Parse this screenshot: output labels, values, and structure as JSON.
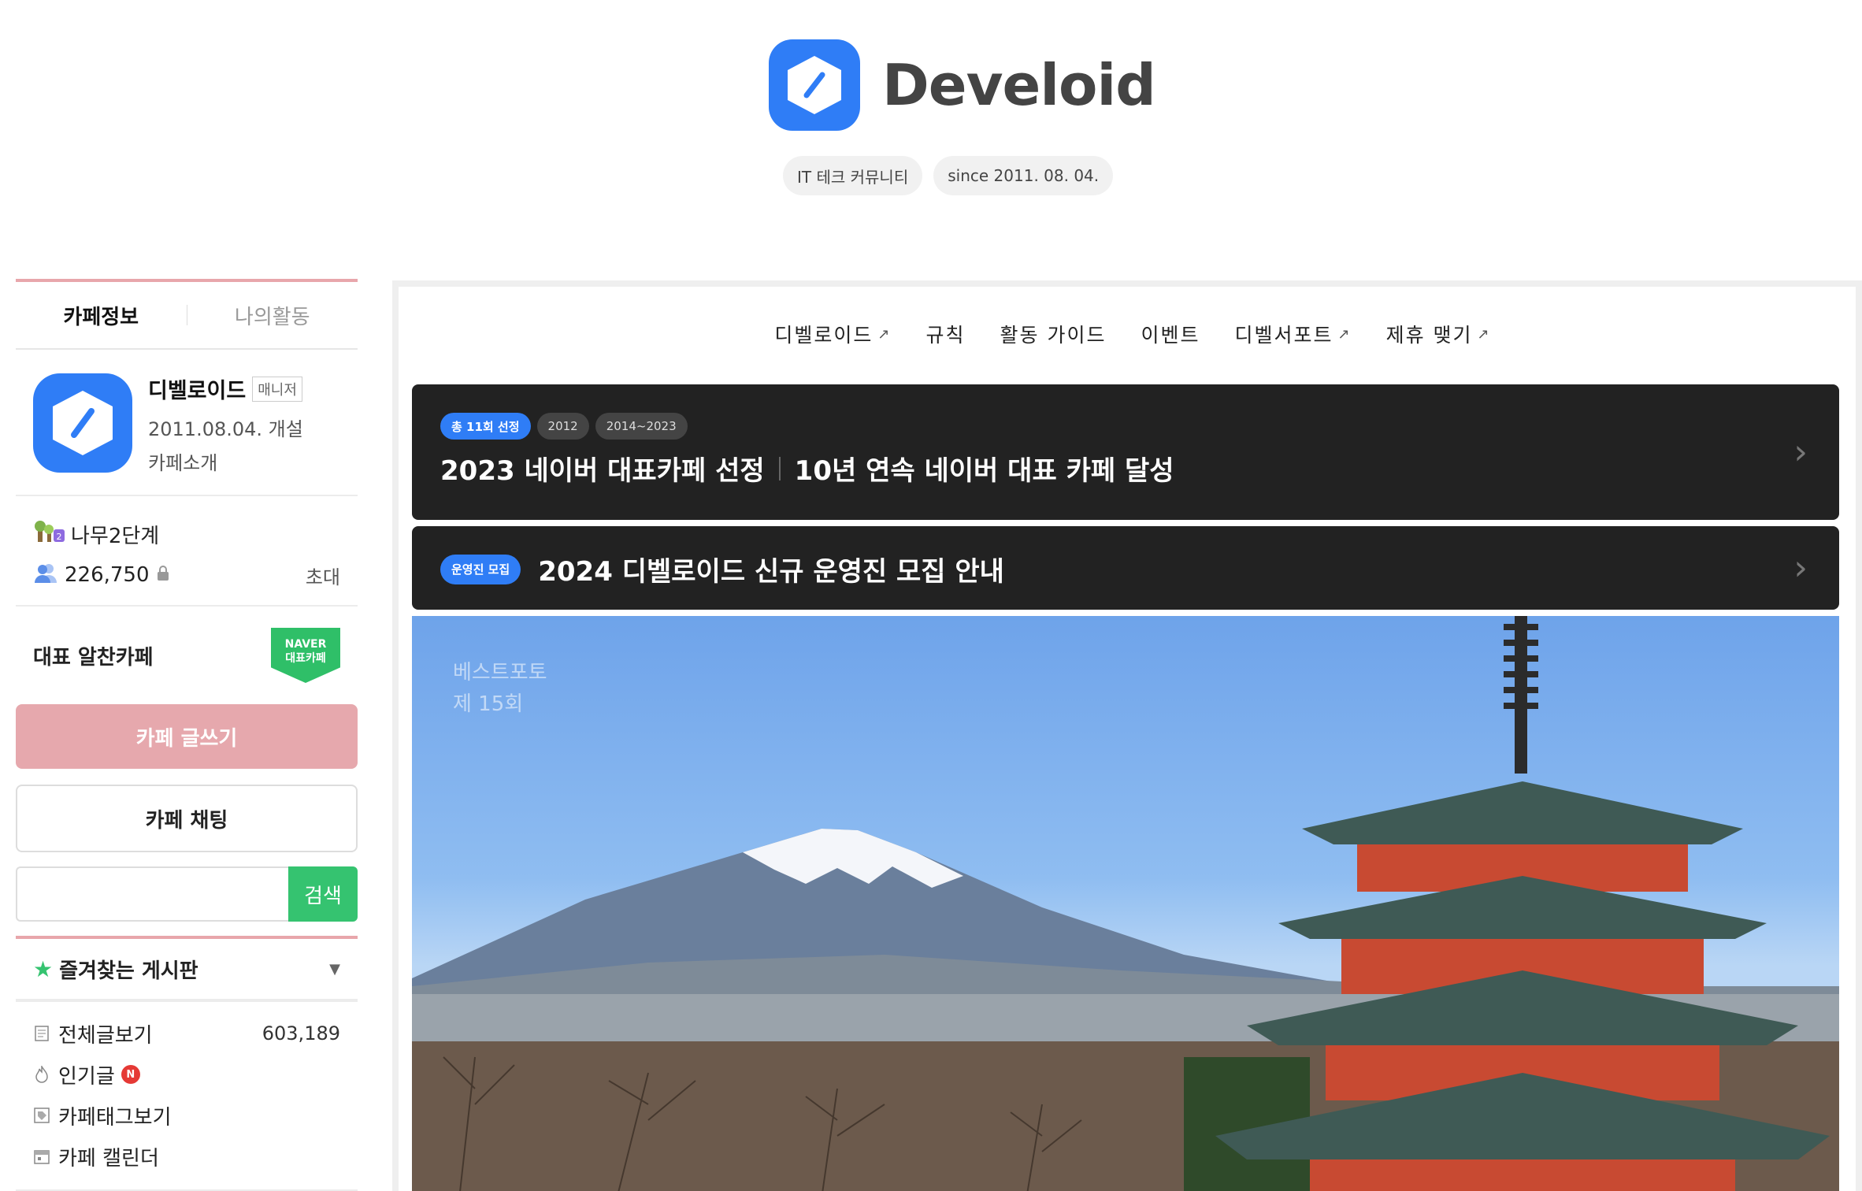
{
  "brand": {
    "name": "Develoid",
    "tags": [
      "IT 테크 커뮤니티",
      "since 2011. 08. 04."
    ],
    "accent": "#2f7df6"
  },
  "sidebar": {
    "tabs": [
      {
        "label": "카페정보",
        "active": true
      },
      {
        "label": "나의활동",
        "active": false
      }
    ],
    "cafe": {
      "name": "디벨로이드",
      "role_badge": "매니저",
      "founded": "2011.08.04. 개설",
      "intro_link": "카페소개"
    },
    "level": "나무2단계",
    "members": "226,750",
    "invite": "초대",
    "representative_label": "대표 알찬카페",
    "naver_badge": [
      "NAVER",
      "대표카페"
    ],
    "write_button": "카페 글쓰기",
    "chat_button": "카페 채팅",
    "search": {
      "value": "",
      "button": "검색"
    },
    "favorites_title": "즐겨찾는 게시판",
    "menu": [
      {
        "label": "전체글보기",
        "count": "603,189",
        "icon": "document-icon"
      },
      {
        "label": "인기글",
        "badge": "N",
        "icon": "flame-icon"
      },
      {
        "label": "카페태그보기",
        "icon": "tag-icon"
      },
      {
        "label": "카페 캘린더",
        "icon": "calendar-icon"
      }
    ],
    "colors": {
      "pink": "#e6a8ad",
      "green": "#35c370"
    }
  },
  "main": {
    "nav": [
      {
        "label": "디벨로이드",
        "external": true
      },
      {
        "label": "규칙",
        "external": false
      },
      {
        "label": "활동 가이드",
        "external": false
      },
      {
        "label": "이벤트",
        "external": false
      },
      {
        "label": "디벨서포트",
        "external": true
      },
      {
        "label": "제휴 맺기",
        "external": true
      }
    ],
    "banner1": {
      "chips": [
        "총 11회 선정",
        "2012",
        "2014~2023"
      ],
      "title_left": "2023 네이버 대표카페 선정",
      "title_right": "10년 연속 네이버 대표 카페 달성"
    },
    "banner2": {
      "chip": "운영진 모집",
      "title": "2024 디벨로이드 신규 운영진 모집 안내"
    },
    "photo": {
      "caption_line1": "베스트포토",
      "caption_line2": "제 15회"
    }
  }
}
